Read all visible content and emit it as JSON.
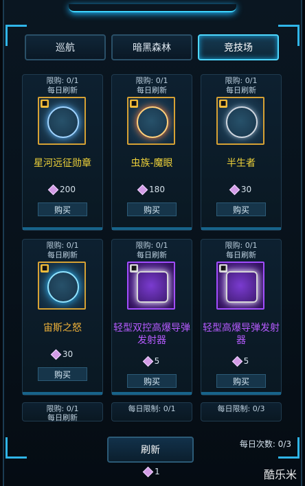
{
  "tabs": [
    {
      "label": "巡航"
    },
    {
      "label": "暗黑森林"
    },
    {
      "label": "竞技场"
    }
  ],
  "activeTab": 2,
  "cards": [
    {
      "limit": "限购: 0/1",
      "refresh": "每日刷新",
      "name": "星河远征勋章",
      "nameColor": "yellow",
      "price": "200",
      "buy": "购买",
      "icon": "starmedal-icon"
    },
    {
      "limit": "限购: 0/1",
      "refresh": "每日刷新",
      "name": "虫族-魔眼",
      "nameColor": "yellow",
      "price": "180",
      "buy": "购买",
      "icon": "demon-eye-icon"
    },
    {
      "limit": "限购: 0/1",
      "refresh": "每日刷新",
      "name": "半生者",
      "nameColor": "yellow",
      "price": "30",
      "buy": "购买",
      "icon": "skull-emblem-icon"
    },
    {
      "limit": "限购: 0/1",
      "refresh": "每日刷新",
      "name": "宙斯之怒",
      "nameColor": "orange",
      "price": "30",
      "buy": "购买",
      "icon": "zeus-emblem-icon"
    },
    {
      "limit": "限购: 0/1",
      "refresh": "每日刷新",
      "name": "轻型双控高爆导弹发射器",
      "nameColor": "purple",
      "price": "5",
      "buy": "购买",
      "icon": "launcher-icon"
    },
    {
      "limit": "限购: 0/1",
      "refresh": "每日刷新",
      "name": "轻型高爆导弹发射器",
      "nameColor": "purple",
      "price": "5",
      "buy": "购买",
      "icon": "launcher-icon"
    }
  ],
  "bottomCards": [
    {
      "line1": "限购: 0/1",
      "line2": "每日刷新"
    },
    {
      "line1": "每日限制: 0/1",
      "line2": ""
    },
    {
      "line1": "每日限制: 0/3",
      "line2": ""
    }
  ],
  "refresh": {
    "label": "刷新",
    "cost": "1"
  },
  "daily": {
    "label": "每日次数: 0/3"
  },
  "watermark": "酷乐米"
}
